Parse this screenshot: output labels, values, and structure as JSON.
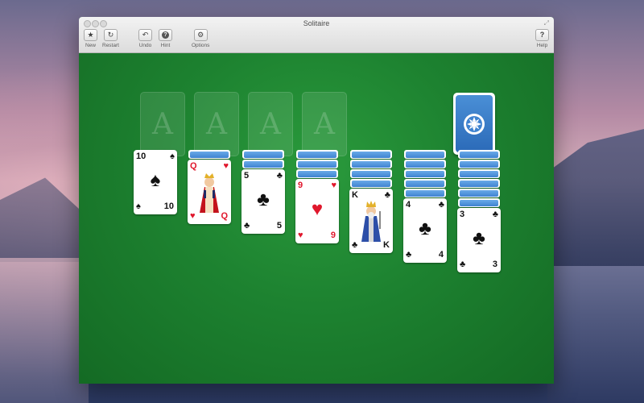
{
  "window": {
    "title": "Solitaire"
  },
  "toolbar": {
    "new_label": "New",
    "restart_label": "Restart",
    "undo_label": "Undo",
    "hint_label": "Hint",
    "options_label": "Options",
    "help_label": "Help"
  },
  "icons": {
    "new": "star-icon",
    "restart": "restart-icon",
    "undo": "undo-icon",
    "hint": "hint-icon",
    "options": "gear-icon",
    "help": "help-icon"
  },
  "foundations": [
    {
      "label": "A"
    },
    {
      "label": "A"
    },
    {
      "label": "A"
    },
    {
      "label": "A"
    }
  ],
  "tableau": [
    {
      "face_down": 0,
      "rank": "10",
      "suit": "♠",
      "color": "black"
    },
    {
      "face_down": 1,
      "rank": "Q",
      "suit": "♥",
      "color": "red",
      "face_card": "queen"
    },
    {
      "face_down": 2,
      "rank": "5",
      "suit": "♣",
      "color": "black"
    },
    {
      "face_down": 3,
      "rank": "9",
      "suit": "♥",
      "color": "red"
    },
    {
      "face_down": 4,
      "rank": "K",
      "suit": "♣",
      "color": "black",
      "face_card": "king"
    },
    {
      "face_down": 5,
      "rank": "4",
      "suit": "♣",
      "color": "black"
    },
    {
      "face_down": 6,
      "rank": "3",
      "suit": "♣",
      "color": "black"
    }
  ],
  "colors": {
    "felt": "#1d7d2c",
    "card_back": "#3f83d0",
    "red_suit": "#e0172c"
  }
}
